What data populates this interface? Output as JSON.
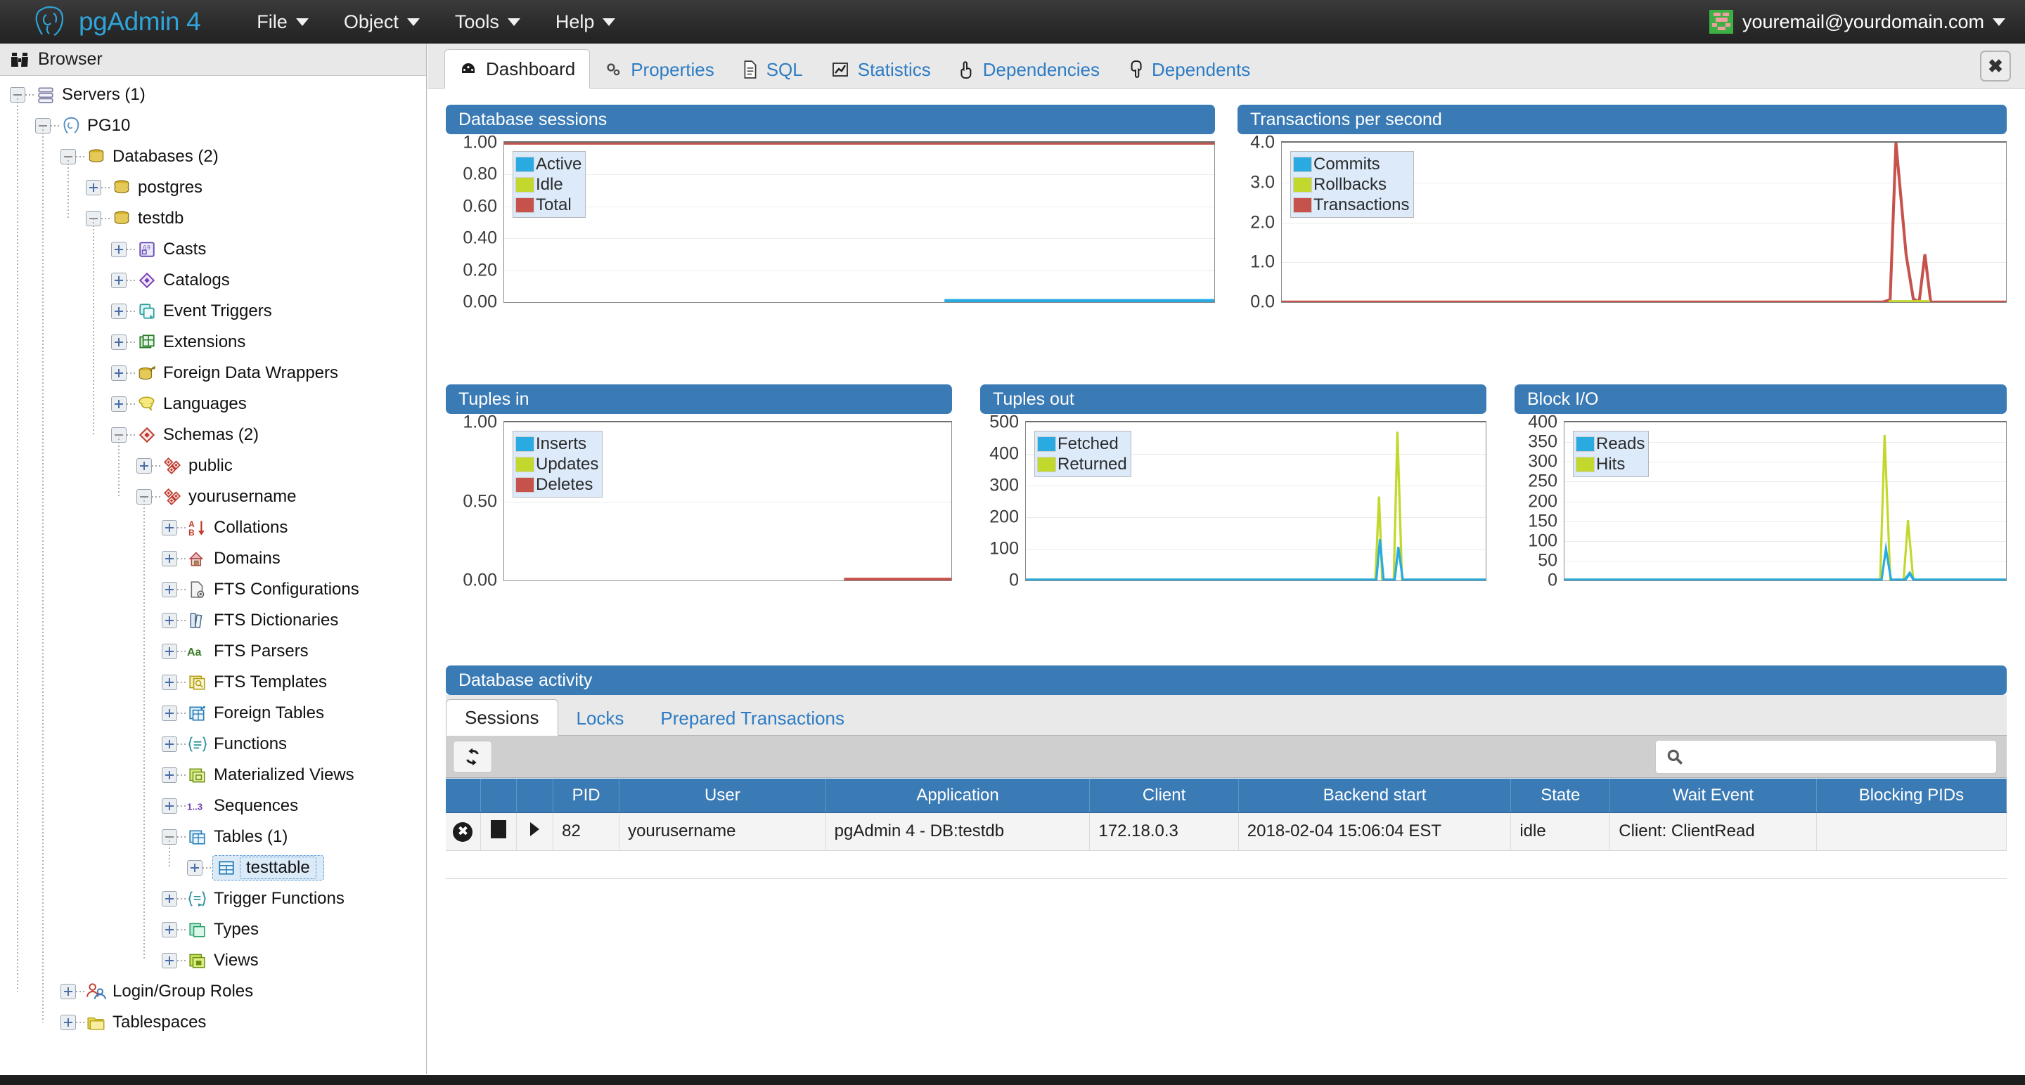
{
  "app": {
    "brand": "pgAdmin 4",
    "logo_icon": "postgresql-elephant-icon",
    "menus": [
      {
        "label": "File"
      },
      {
        "label": "Object"
      },
      {
        "label": "Tools"
      },
      {
        "label": "Help"
      }
    ],
    "user_email": "youremail@yourdomain.com",
    "avatar_icon": "gravatar-identicon",
    "accent_blue": "#3b7bb5",
    "link_blue": "#2d7cc4",
    "brand_blue": "#2fa4d8"
  },
  "sidebar": {
    "title": "Browser",
    "title_icon": "binoculars-icon",
    "tree": [
      {
        "label": "Servers (1)",
        "depth": 0,
        "state": "minus",
        "icon": "servers-icon"
      },
      {
        "label": "PG10",
        "depth": 1,
        "state": "minus",
        "icon": "postgres-server-icon"
      },
      {
        "label": "Databases (2)",
        "depth": 2,
        "state": "minus",
        "icon": "database-icon"
      },
      {
        "label": "postgres",
        "depth": 3,
        "state": "plus",
        "icon": "database-icon"
      },
      {
        "label": "testdb",
        "depth": 3,
        "state": "minus",
        "icon": "database-icon"
      },
      {
        "label": "Casts",
        "depth": 4,
        "state": "plus",
        "icon": "casts-icon"
      },
      {
        "label": "Catalogs",
        "depth": 4,
        "state": "plus",
        "icon": "catalogs-icon"
      },
      {
        "label": "Event Triggers",
        "depth": 4,
        "state": "plus",
        "icon": "event-triggers-icon"
      },
      {
        "label": "Extensions",
        "depth": 4,
        "state": "plus",
        "icon": "extensions-icon"
      },
      {
        "label": "Foreign Data Wrappers",
        "depth": 4,
        "state": "plus",
        "icon": "foreign-data-wrappers-icon"
      },
      {
        "label": "Languages",
        "depth": 4,
        "state": "plus",
        "icon": "languages-icon"
      },
      {
        "label": "Schemas (2)",
        "depth": 4,
        "state": "minus",
        "icon": "schemas-icon"
      },
      {
        "label": "public",
        "depth": 5,
        "state": "plus",
        "icon": "schema-icon"
      },
      {
        "label": "yourusername",
        "depth": 5,
        "state": "minus",
        "icon": "schema-icon"
      },
      {
        "label": "Collations",
        "depth": 6,
        "state": "plus",
        "icon": "collations-icon"
      },
      {
        "label": "Domains",
        "depth": 6,
        "state": "plus",
        "icon": "domains-icon"
      },
      {
        "label": "FTS Configurations",
        "depth": 6,
        "state": "plus",
        "icon": "fts-configurations-icon"
      },
      {
        "label": "FTS Dictionaries",
        "depth": 6,
        "state": "plus",
        "icon": "fts-dictionaries-icon"
      },
      {
        "label": "FTS Parsers",
        "depth": 6,
        "state": "plus",
        "icon": "fts-parsers-icon"
      },
      {
        "label": "FTS Templates",
        "depth": 6,
        "state": "plus",
        "icon": "fts-templates-icon"
      },
      {
        "label": "Foreign Tables",
        "depth": 6,
        "state": "plus",
        "icon": "foreign-tables-icon"
      },
      {
        "label": "Functions",
        "depth": 6,
        "state": "plus",
        "icon": "functions-icon"
      },
      {
        "label": "Materialized Views",
        "depth": 6,
        "state": "plus",
        "icon": "materialized-views-icon"
      },
      {
        "label": "Sequences",
        "depth": 6,
        "state": "plus",
        "icon": "sequences-icon"
      },
      {
        "label": "Tables (1)",
        "depth": 6,
        "state": "minus",
        "icon": "tables-icon"
      },
      {
        "label": "testtable",
        "depth": 7,
        "state": "plus",
        "icon": "table-icon",
        "selected": true
      },
      {
        "label": "Trigger Functions",
        "depth": 6,
        "state": "plus",
        "icon": "trigger-functions-icon"
      },
      {
        "label": "Types",
        "depth": 6,
        "state": "plus",
        "icon": "types-icon"
      },
      {
        "label": "Views",
        "depth": 6,
        "state": "plus",
        "icon": "views-icon"
      },
      {
        "label": "Login/Group Roles",
        "depth": 2,
        "state": "plus",
        "icon": "login-group-roles-icon"
      },
      {
        "label": "Tablespaces",
        "depth": 2,
        "state": "plus",
        "icon": "tablespaces-icon"
      }
    ]
  },
  "content_tabs": [
    {
      "label": "Dashboard",
      "icon": "dashboard-icon",
      "active": true
    },
    {
      "label": "Properties",
      "icon": "gears-icon",
      "active": false
    },
    {
      "label": "SQL",
      "icon": "document-icon",
      "active": false
    },
    {
      "label": "Statistics",
      "icon": "chart-line-icon",
      "active": false
    },
    {
      "label": "Dependencies",
      "icon": "hand-up-icon",
      "active": false
    },
    {
      "label": "Dependents",
      "icon": "hand-down-icon",
      "active": false
    }
  ],
  "close_button": {
    "label": "✖",
    "icon": "close-icon"
  },
  "chart_data": [
    {
      "type": "line",
      "title": "Database sessions",
      "xlabel": "",
      "ylabel": "",
      "ylim": [
        0,
        1.0
      ],
      "yticks": [
        "0.00",
        "0.20",
        "0.40",
        "0.60",
        "0.80",
        "1.00"
      ],
      "grid": true,
      "legend_position": "top-left",
      "series": [
        {
          "name": "Active",
          "color": "#29ABE2",
          "values": [
            0,
            0,
            0,
            0,
            0,
            0,
            0,
            0,
            0,
            0,
            0,
            0,
            0,
            0,
            0,
            0,
            0,
            0,
            0,
            0,
            0,
            0,
            0,
            0,
            0,
            0,
            0,
            0,
            0,
            0
          ]
        },
        {
          "name": "Idle",
          "color": "#C3D82C",
          "values": [
            0,
            0,
            0,
            0,
            0,
            0,
            0,
            0,
            0,
            0,
            0,
            0,
            0,
            0,
            0,
            0,
            0,
            0,
            0,
            0,
            0,
            0,
            0,
            0,
            0,
            0,
            0,
            0,
            0,
            0
          ]
        },
        {
          "name": "Total",
          "color": "#C6524C",
          "values": [
            1,
            1,
            1,
            1,
            1,
            1,
            1,
            1,
            1,
            1,
            1,
            1,
            1,
            1,
            1,
            1,
            1,
            1,
            1,
            1,
            1,
            1,
            1,
            1,
            1,
            1,
            1,
            1,
            1,
            1
          ]
        }
      ]
    },
    {
      "type": "line",
      "title": "Transactions per second",
      "xlabel": "",
      "ylabel": "",
      "ylim": [
        0,
        4.0
      ],
      "yticks": [
        "0.0",
        "1.0",
        "2.0",
        "3.0",
        "4.0"
      ],
      "grid": true,
      "legend_position": "top-left",
      "series": [
        {
          "name": "Commits",
          "color": "#29ABE2",
          "values": [
            0,
            0,
            0,
            0,
            0,
            0,
            0,
            0,
            0,
            0,
            0,
            0,
            0,
            0,
            0,
            0,
            0,
            0,
            0,
            0,
            0,
            0,
            0,
            0,
            0,
            0,
            0,
            0,
            0,
            0
          ]
        },
        {
          "name": "Rollbacks",
          "color": "#C3D82C",
          "values": [
            0,
            0,
            0,
            0,
            0,
            0,
            0,
            0,
            0,
            0,
            0,
            0,
            0,
            0,
            0,
            0,
            0,
            0,
            0,
            0,
            0,
            0,
            0,
            0,
            0,
            0,
            0,
            0,
            0,
            0
          ]
        },
        {
          "name": "Transactions",
          "color": "#C6524C",
          "values": [
            0,
            0,
            0,
            0,
            0,
            0,
            0,
            0,
            0,
            0,
            0,
            0,
            0,
            0,
            0,
            0,
            0,
            0,
            0,
            0,
            0,
            0,
            0,
            0,
            0.05,
            4.0,
            0.9,
            0,
            1.2,
            0,
            0,
            0
          ]
        }
      ]
    },
    {
      "type": "line",
      "title": "Tuples in",
      "xlabel": "",
      "ylabel": "",
      "ylim": [
        0,
        1.0
      ],
      "yticks": [
        "0.00",
        "0.50",
        "1.00"
      ],
      "grid": true,
      "legend_position": "top-left",
      "series": [
        {
          "name": "Inserts",
          "color": "#29ABE2",
          "values": [
            0,
            0,
            0,
            0,
            0,
            0,
            0,
            0,
            0,
            0,
            0,
            0,
            0,
            0,
            0,
            0,
            0,
            0,
            0,
            0,
            0,
            0,
            0,
            0,
            0,
            0,
            0,
            0,
            0,
            0
          ]
        },
        {
          "name": "Updates",
          "color": "#C3D82C",
          "values": [
            0,
            0,
            0,
            0,
            0,
            0,
            0,
            0,
            0,
            0,
            0,
            0,
            0,
            0,
            0,
            0,
            0,
            0,
            0,
            0,
            0,
            0,
            0,
            0,
            0,
            0,
            0,
            0,
            0,
            0
          ]
        },
        {
          "name": "Deletes",
          "color": "#C6524C",
          "values": [
            0,
            0,
            0,
            0,
            0,
            0,
            0,
            0,
            0,
            0,
            0,
            0,
            0,
            0,
            0,
            0,
            0,
            0,
            0,
            0,
            0,
            0,
            0,
            0,
            0,
            0,
            0,
            0,
            0,
            0
          ]
        }
      ]
    },
    {
      "type": "line",
      "title": "Tuples out",
      "xlabel": "",
      "ylabel": "",
      "ylim": [
        0,
        500
      ],
      "yticks": [
        "0",
        "100",
        "200",
        "300",
        "400",
        "500"
      ],
      "grid": true,
      "legend_position": "top-left",
      "series": [
        {
          "name": "Fetched",
          "color": "#29ABE2",
          "values": [
            0,
            0,
            0,
            0,
            0,
            0,
            0,
            0,
            0,
            0,
            0,
            0,
            0,
            0,
            0,
            0,
            0,
            0,
            0,
            0,
            0,
            0,
            0,
            0,
            0,
            130,
            0,
            0,
            105,
            0,
            0,
            0
          ]
        },
        {
          "name": "Returned",
          "color": "#C3D82C",
          "values": [
            0,
            0,
            0,
            0,
            0,
            0,
            0,
            0,
            0,
            0,
            0,
            0,
            0,
            0,
            0,
            0,
            0,
            0,
            0,
            0,
            0,
            0,
            0,
            0,
            0,
            265,
            0,
            0,
            450,
            0,
            0,
            0
          ]
        }
      ]
    },
    {
      "type": "line",
      "title": "Block I/O",
      "xlabel": "",
      "ylabel": "",
      "ylim": [
        0,
        400
      ],
      "yticks": [
        "0",
        "50",
        "100",
        "150",
        "200",
        "250",
        "300",
        "350",
        "400"
      ],
      "grid": true,
      "legend_position": "top-left",
      "series": [
        {
          "name": "Reads",
          "color": "#29ABE2",
          "values": [
            0,
            0,
            0,
            0,
            0,
            0,
            0,
            0,
            0,
            0,
            0,
            0,
            0,
            0,
            0,
            0,
            0,
            0,
            0,
            0,
            0,
            0,
            0,
            0,
            0,
            80,
            0,
            0,
            18,
            0,
            0,
            0
          ]
        },
        {
          "name": "Hits",
          "color": "#C3D82C",
          "values": [
            0,
            0,
            0,
            0,
            0,
            0,
            0,
            0,
            0,
            0,
            0,
            0,
            0,
            0,
            0,
            0,
            0,
            0,
            0,
            0,
            0,
            0,
            0,
            0,
            0,
            368,
            0,
            0,
            152,
            0,
            0,
            0
          ]
        }
      ]
    }
  ],
  "activity": {
    "title": "Database activity",
    "tabs": [
      {
        "label": "Sessions",
        "active": true
      },
      {
        "label": "Locks",
        "active": false
      },
      {
        "label": "Prepared Transactions",
        "active": false
      }
    ],
    "refresh_icon": "refresh-icon",
    "search": {
      "placeholder": "",
      "value": "",
      "icon": "search-icon"
    },
    "columns": [
      "",
      "",
      "",
      "PID",
      "User",
      "Application",
      "Client",
      "Backend start",
      "State",
      "Wait Event",
      "Blocking PIDs"
    ],
    "rows": [
      {
        "cancel_icon": "cancel-query-icon",
        "terminate_icon": "terminate-session-icon",
        "expand_icon": "expand-row-icon",
        "pid": "82",
        "user": "yourusername",
        "application": "pgAdmin 4 - DB:testdb",
        "client": "172.18.0.3",
        "backend_start": "2018-02-04 15:06:04 EST",
        "state": "idle",
        "wait_event": "Client: ClientRead",
        "blocking_pids": ""
      }
    ]
  }
}
